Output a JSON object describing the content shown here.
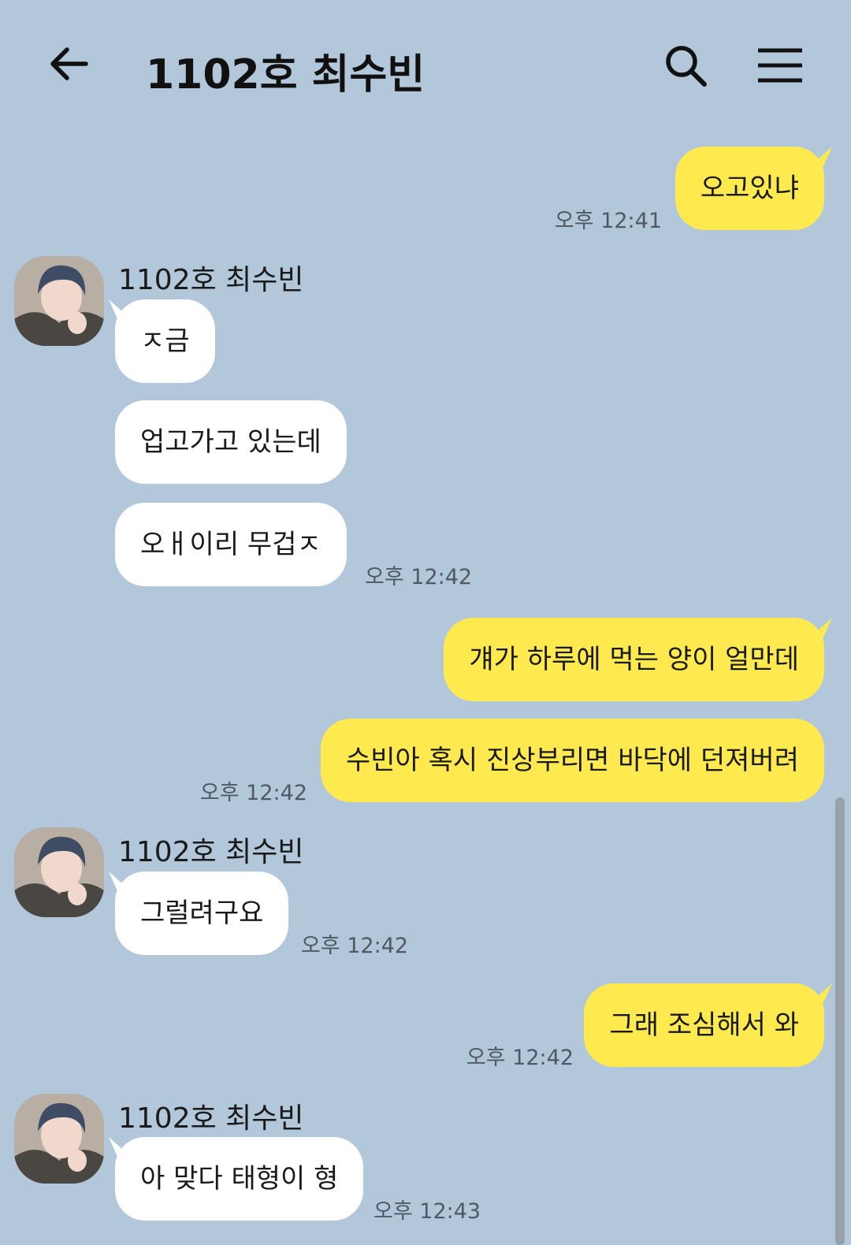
{
  "header": {
    "title": "1102호 최수빈",
    "back_icon": "arrow-left-icon",
    "search_icon": "search-icon",
    "menu_icon": "hamburger-menu-icon"
  },
  "colors": {
    "background": "#b2c7da",
    "outgoing_bubble": "#fee94f",
    "incoming_bubble": "#ffffff"
  },
  "messages": [
    {
      "direction": "out",
      "text": "오고있냐",
      "time": "오후 12:41"
    },
    {
      "direction": "in",
      "sender": "1102호 최수빈",
      "text": "ㅈ금"
    },
    {
      "direction": "in",
      "text": "업고가고 있는데"
    },
    {
      "direction": "in",
      "text": "오ㅐ이리 무겁ㅈ",
      "time": "오후 12:42"
    },
    {
      "direction": "out",
      "text": "걔가 하루에 먹는 양이 얼만데"
    },
    {
      "direction": "out",
      "text": "수빈아 혹시 진상부리면 바닥에 던져버려",
      "time": "오후 12:42"
    },
    {
      "direction": "in",
      "sender": "1102호 최수빈",
      "text": "그럴려구요",
      "time": "오후 12:42"
    },
    {
      "direction": "out",
      "text": "그래 조심해서 와",
      "time": "오후 12:42"
    },
    {
      "direction": "in",
      "sender": "1102호 최수빈",
      "text": "아 맞다 태형이 형",
      "time": "오후 12:43"
    }
  ]
}
